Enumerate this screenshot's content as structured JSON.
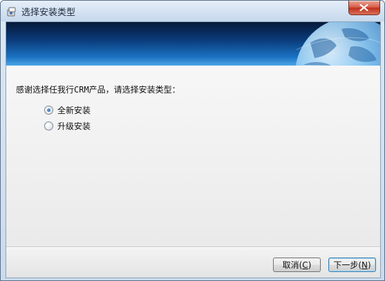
{
  "window": {
    "title": "选择安装类型"
  },
  "content": {
    "prompt": "感谢选择任我行CRM产品，请选择安装类型：",
    "options": [
      {
        "label": "全新安装",
        "selected": true
      },
      {
        "label": "升级安装",
        "selected": false
      }
    ]
  },
  "buttons": {
    "cancel": {
      "label": "取消(",
      "accel": "C",
      "suffix": ")"
    },
    "next": {
      "label": "下一步(",
      "accel": "N",
      "suffix": ")"
    }
  }
}
